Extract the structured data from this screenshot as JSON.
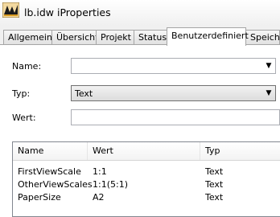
{
  "window": {
    "title": "lb.idw iProperties"
  },
  "tabs": [
    {
      "label": "Allgemein"
    },
    {
      "label": "Übersicht"
    },
    {
      "label": "Projekt"
    },
    {
      "label": "Status"
    },
    {
      "label": "Benutzerdefiniert",
      "active": true
    },
    {
      "label": "Speicher"
    }
  ],
  "form": {
    "name_label": "Name:",
    "name_value": "",
    "type_label": "Typ:",
    "type_value": "Text",
    "value_label": "Wert:",
    "value_value": ""
  },
  "table": {
    "columns": [
      "Name",
      "Wert",
      "Typ"
    ],
    "rows": [
      {
        "name": "FirstViewScale",
        "value": "1:1",
        "type": "Text"
      },
      {
        "name": "OtherViewScales",
        "value": "1:1(5:1)",
        "type": "Text"
      },
      {
        "name": "PaperSize",
        "value": "A2",
        "type": "Text"
      }
    ]
  },
  "icons": {
    "app": "inventor-app-icon",
    "dropdown": "chevron-down-icon"
  },
  "colors": {
    "tab_border": "#a5a5a5",
    "field_border": "#abadb3",
    "window_bg": "#f0f0f0"
  }
}
